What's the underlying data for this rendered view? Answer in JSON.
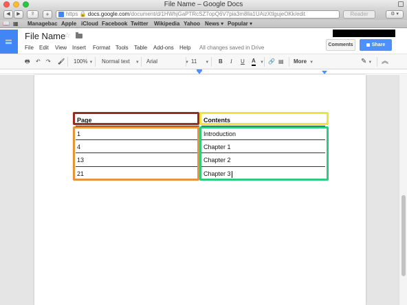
{
  "window": {
    "title": "File Name – Google Docs"
  },
  "browser": {
    "url_scheme": "https",
    "url_host": "docs.google.com",
    "url_path": "/document/d/1HWhjGaPTRcSZ7opQ6V7pia3m8lla1UAizXtlgujeOKk/edit",
    "reader_label": "Reader",
    "bookmarks": [
      "Managebac",
      "Apple",
      "iCloud",
      "Facebook",
      "Twitter",
      "Wikipedia",
      "Yahoo",
      "News ▾",
      "Popular ▾"
    ]
  },
  "docs": {
    "file_name": "File Name",
    "menus": [
      "File",
      "Edit",
      "View",
      "Insert",
      "Format",
      "Tools",
      "Table",
      "Add-ons",
      "Help"
    ],
    "save_status": "All changes saved in Drive",
    "comments_label": "Comments",
    "share_label": "Share"
  },
  "toolbar": {
    "zoom": "100%",
    "style": "Normal text",
    "font": "Arial",
    "size": "11",
    "bold": "B",
    "italic": "I",
    "underline": "U",
    "text_color": "A",
    "more": "More"
  },
  "table": {
    "headers": [
      "Page",
      "Contents"
    ],
    "rows": [
      [
        "1",
        "Introduction"
      ],
      [
        "4",
        "Chapter 1"
      ],
      [
        "13",
        "Chapter 2"
      ],
      [
        "21",
        "Chapter 3"
      ]
    ]
  },
  "colors": {
    "header_page_box": "#9b2b1f",
    "header_contents_box": "#f1e23a",
    "page_column_box": "#e8923a",
    "contents_column_box": "#2ecc7a",
    "share_button": "#4d90fe"
  }
}
